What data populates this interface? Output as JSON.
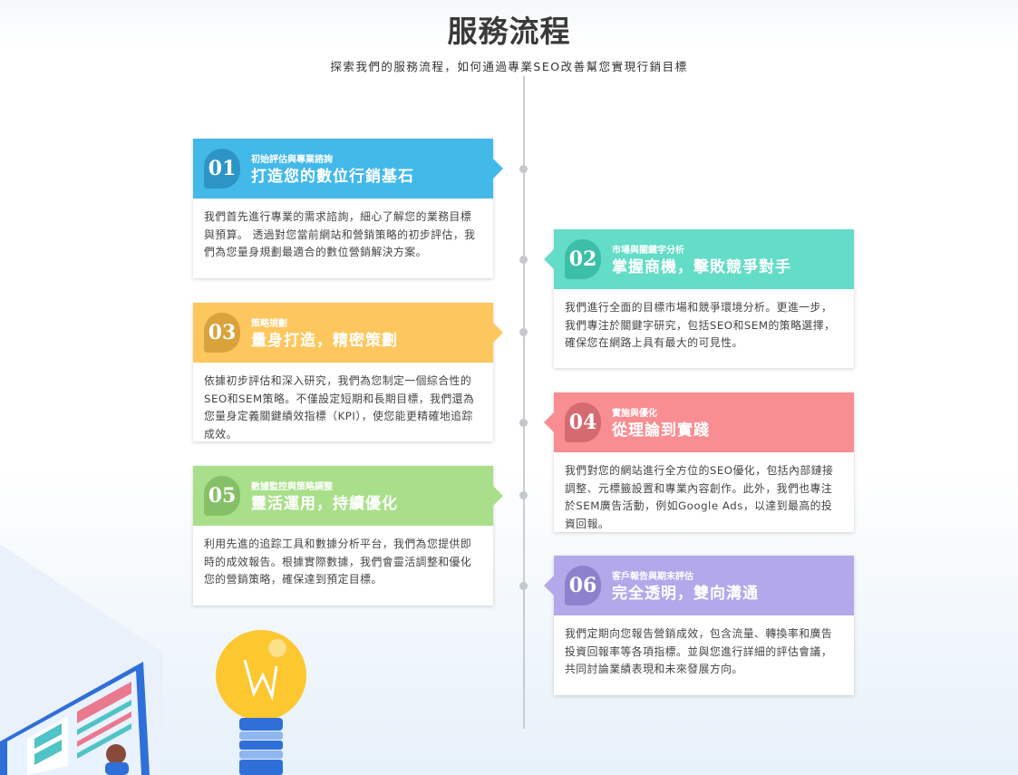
{
  "header": {
    "title": "服務流程",
    "subtitle": "探索我們的服務流程，如何通過專業SEO改善幫您實現行銷目標"
  },
  "colors": {
    "blue": "#43b9ea",
    "teal": "#63dcc8",
    "yellow": "#fdc75d",
    "red": "#f98e92",
    "green": "#a9df8a",
    "purple": "#b3a8ea"
  },
  "steps": [
    {
      "number": "01",
      "kicker": "初始評估與專業諮詢",
      "heading": "打造您的數位行銷基石",
      "body": "我們首先進行專業的需求諮詢，細心了解您的業務目標與預算。 透過對您當前網站和營銷策略的初步評估，我們為您量身規劃最適合的數位營銷解決方案。"
    },
    {
      "number": "02",
      "kicker": "市場與關鍵字分析",
      "heading": "掌握商機，擊敗競爭對手",
      "body": "我們進行全面的目標市場和競爭環境分析。更進一步，我們專注於關鍵字研究，包括SEO和SEM的策略選擇，確保您在網路上具有最大的可見性。"
    },
    {
      "number": "03",
      "kicker": "策略規劃",
      "heading": "量身打造，精密策劃",
      "body": "依據初步評估和深入研究，我們為您制定一個綜合性的SEO和SEM策略。不僅設定短期和長期目標，我們還為您量身定義關鍵績效指標（KPI），使您能更精確地追踪成效。"
    },
    {
      "number": "04",
      "kicker": "實施與優化",
      "heading": "從理論到實踐",
      "body": "我們對您的網站進行全方位的SEO優化，包括內部鏈接調整、元標籤設置和專業內容創作。此外，我們也專注於SEM廣告活動，例如Google Ads，以達到最高的投資回報。"
    },
    {
      "number": "05",
      "kicker": "數據監控與策略調整",
      "heading": "靈活運用，持續優化",
      "body": "利用先進的追踪工具和數據分析平台，我們為您提供即時的成效報告。根據實際數據，我們會靈活調整和優化您的營銷策略，確保達到預定目標。"
    },
    {
      "number": "06",
      "kicker": "客戶報告與期末評估",
      "heading": "完全透明，雙向溝通",
      "body": "我們定期向您報告營銷成效，包含流量、轉換率和廣告投資回報率等各項指標。並與您進行詳細的評估會議，共同討論業績表現和未來發展方向。"
    }
  ]
}
